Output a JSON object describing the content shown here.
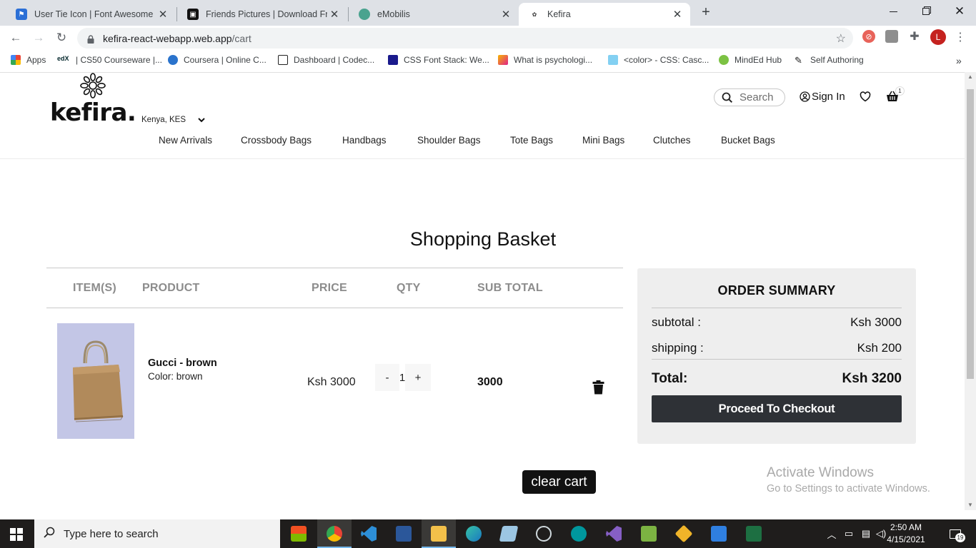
{
  "browser": {
    "tabs": [
      {
        "title": "User Tie Icon | Font Awesome",
        "active": false
      },
      {
        "title": "Friends Pictures | Download Free",
        "active": false
      },
      {
        "title": "eMobilis",
        "active": false
      },
      {
        "title": "Kefira",
        "active": true
      }
    ],
    "new_tab": "+",
    "window_controls": {
      "minimize": "—",
      "maximize": "❐",
      "close": "✕"
    },
    "url": {
      "host": "kefira-react-webapp.web.app",
      "path": "/cart"
    },
    "profile_initial": "L",
    "bookmarks": [
      {
        "label": "Apps",
        "icon": "apps-grid-icon"
      },
      {
        "label": "| CS50 Courseware |...",
        "icon": "edx-icon"
      },
      {
        "label": "Coursera | Online C...",
        "icon": "coursera-icon"
      },
      {
        "label": "Dashboard | Codec...",
        "icon": "codecademy-icon"
      },
      {
        "label": "CSS Font Stack: We...",
        "icon": "cssfontstack-icon"
      },
      {
        "label": "What is psychologi...",
        "icon": "psychology-icon"
      },
      {
        "label": "<color> - CSS: Casc...",
        "icon": "mdn-icon"
      },
      {
        "label": "MindEd Hub",
        "icon": "minded-icon"
      },
      {
        "label": "Self Authoring",
        "icon": "pen-icon"
      }
    ],
    "bookmarks_overflow": "»"
  },
  "site": {
    "logo_text": "kefira.",
    "region": "Kenya, KES",
    "search_placeholder": "Search",
    "sign_in": "Sign In",
    "cart_count": "1",
    "nav": [
      "New Arrivals",
      "Crossbody Bags",
      "Handbags",
      "Shoulder Bags",
      "Tote Bags",
      "Mini Bags",
      "Clutches",
      "Bucket Bags"
    ]
  },
  "cart": {
    "title": "Shopping Basket",
    "columns": [
      "ITEM(S)",
      "PRODUCT",
      "PRICE",
      "QTY",
      "SUB TOTAL"
    ],
    "items": [
      {
        "name": "Gucci - brown",
        "color_label": "Color: brown",
        "price": "Ksh 3000",
        "qty": "1",
        "subtotal": "3000",
        "decrement": "-",
        "increment": "+"
      }
    ],
    "clear_label": "clear cart"
  },
  "summary": {
    "title": "ORDER SUMMARY",
    "subtotal_label": "subtotal :",
    "subtotal_value": "Ksh 3000",
    "shipping_label": "shipping :",
    "shipping_value": "Ksh 200",
    "total_label": "Total:",
    "total_value": "Ksh 3200",
    "checkout_label": "Proceed To Checkout"
  },
  "watermark": {
    "line1": "Activate Windows",
    "line2": "Go to Settings to activate Windows."
  },
  "taskbar": {
    "search_placeholder": "Type here to search",
    "time": "2:50 AM",
    "date": "4/15/2021",
    "notification_count": "19"
  },
  "colors": {
    "summary_bg": "#eeeeee",
    "checkout_bg": "#2e3136",
    "product_image_bg": "#c3c6e6",
    "taskbar_bg": "#1f1d1c"
  }
}
